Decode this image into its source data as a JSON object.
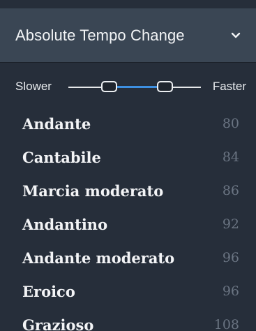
{
  "panel": {
    "header": {
      "title": "Absolute Tempo Change",
      "expand_icon": "chevron-down-icon"
    },
    "slider": {
      "left_label": "Slower",
      "right_label": "Faster",
      "range_low": 0.26,
      "range_high": 0.68
    },
    "tempos": [
      {
        "name": "Andante",
        "bpm": "80"
      },
      {
        "name": "Cantabile",
        "bpm": "84"
      },
      {
        "name": "Marcia moderato",
        "bpm": "86"
      },
      {
        "name": "Andantino",
        "bpm": "92"
      },
      {
        "name": "Andante moderato",
        "bpm": "96"
      },
      {
        "name": "Eroico",
        "bpm": "96"
      },
      {
        "name": "Grazioso",
        "bpm": "108"
      }
    ]
  },
  "colors": {
    "background": "#262e3a",
    "header": "#3a4654",
    "accent": "#3d8fe0",
    "muted_text": "#6a7482"
  }
}
